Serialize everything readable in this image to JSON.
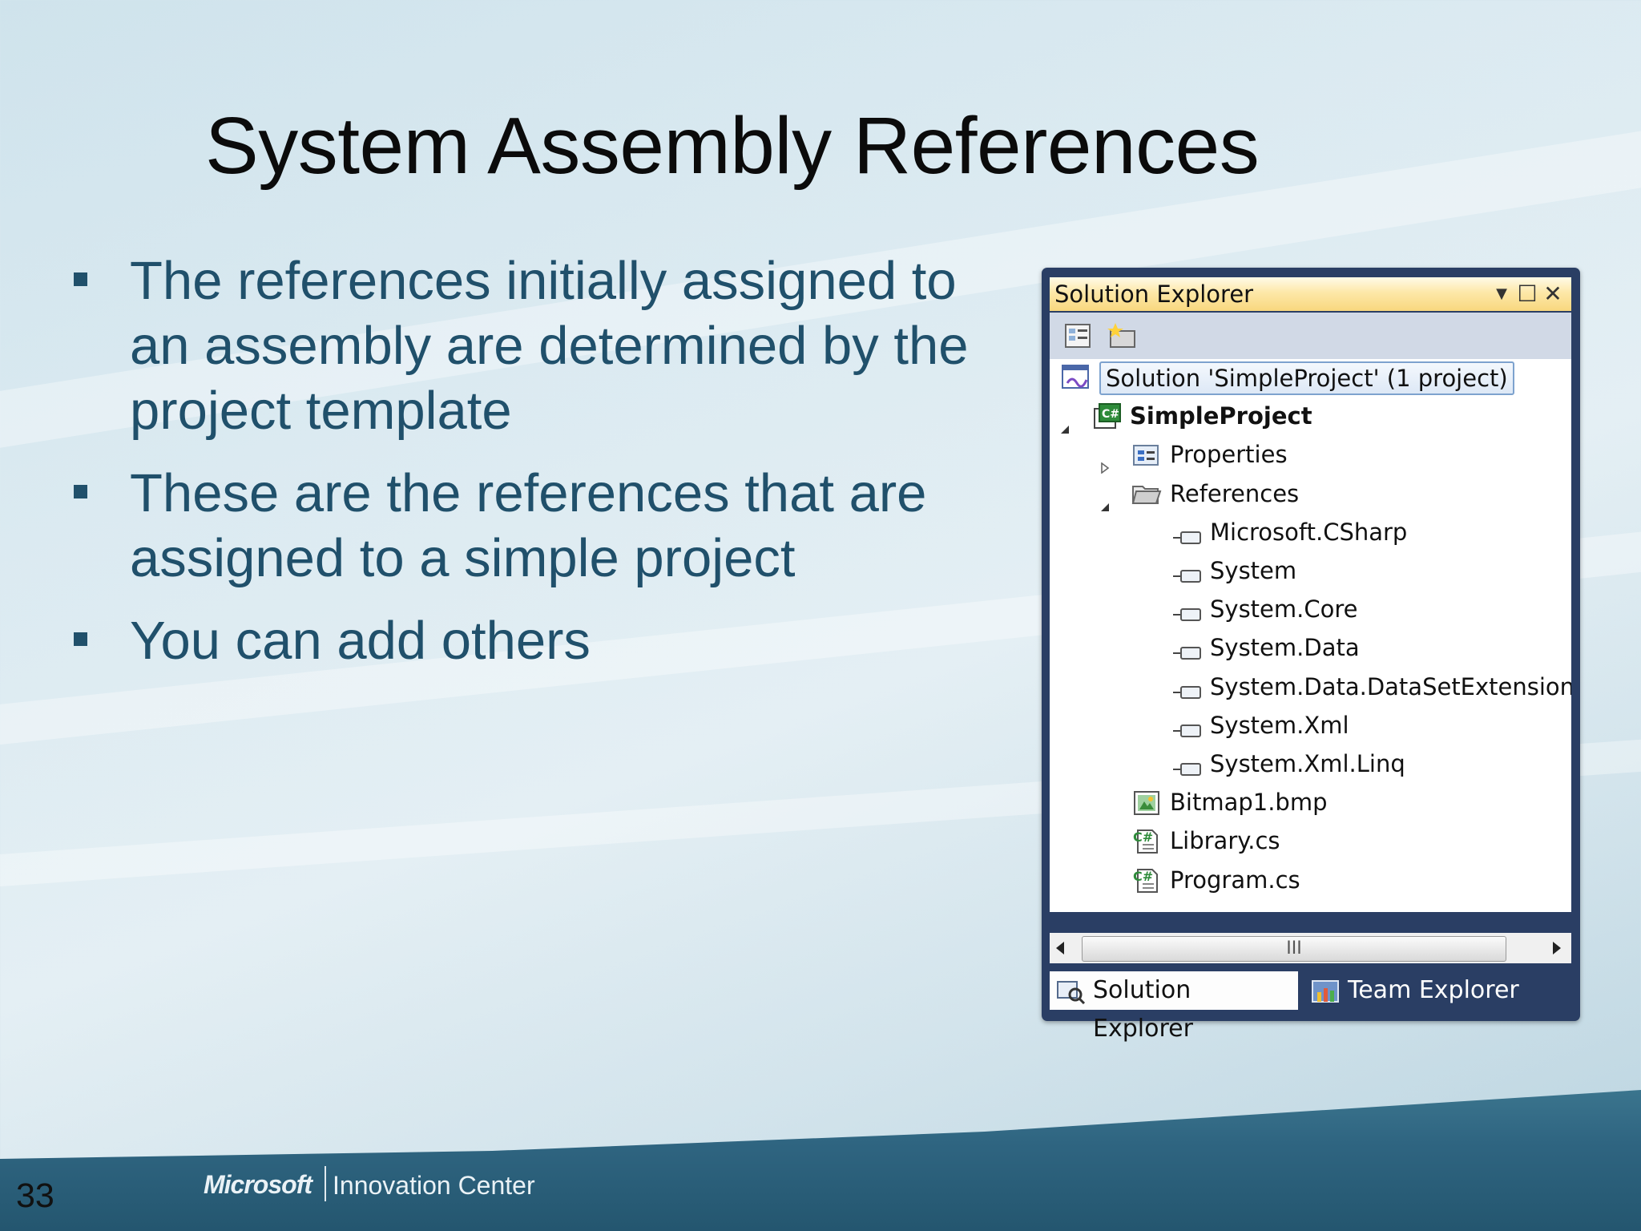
{
  "slide": {
    "title": "System Assembly References",
    "bullets": [
      "The references initially assigned to an assembly are determined by the project template",
      "These are the references that are assigned to a simple project",
      "You can add others"
    ],
    "number": "33"
  },
  "footer": {
    "logo_text": "Microsoft",
    "brand_text": "Innovation Center"
  },
  "solution_explorer": {
    "title": "Solution Explorer",
    "controls": {
      "dropdown": "▼",
      "maximize": "☐",
      "close": "✕"
    },
    "tree": [
      {
        "label": "Solution 'SimpleProject' (1 project)",
        "icon": "solution-icon",
        "selected": true
      },
      {
        "label": "SimpleProject",
        "icon": "csharp-project-icon",
        "bold": true,
        "expanded": true
      },
      {
        "label": "Properties",
        "icon": "properties-icon",
        "expanded": false
      },
      {
        "label": "References",
        "icon": "folder-open-icon",
        "expanded": true
      },
      {
        "label": "Microsoft.CSharp",
        "icon": "reference-icon"
      },
      {
        "label": "System",
        "icon": "reference-icon"
      },
      {
        "label": "System.Core",
        "icon": "reference-icon"
      },
      {
        "label": "System.Data",
        "icon": "reference-icon"
      },
      {
        "label": "System.Data.DataSetExtensions",
        "icon": "reference-icon"
      },
      {
        "label": "System.Xml",
        "icon": "reference-icon"
      },
      {
        "label": "System.Xml.Linq",
        "icon": "reference-icon"
      },
      {
        "label": "Bitmap1.bmp",
        "icon": "bitmap-icon"
      },
      {
        "label": "Library.cs",
        "icon": "csharp-file-icon"
      },
      {
        "label": "Program.cs",
        "icon": "csharp-file-icon"
      }
    ],
    "scrollbar": {
      "grip": "III"
    },
    "tabs": [
      {
        "label": "Solution Explorer",
        "icon": "solution-explorer-icon",
        "active": true
      },
      {
        "label": "Team Explorer",
        "icon": "team-explorer-icon",
        "active": false
      }
    ]
  },
  "colors": {
    "bullet_text": "#20506b",
    "title_bar": "#fde8a8",
    "panel_frame": "#2a3e64"
  }
}
